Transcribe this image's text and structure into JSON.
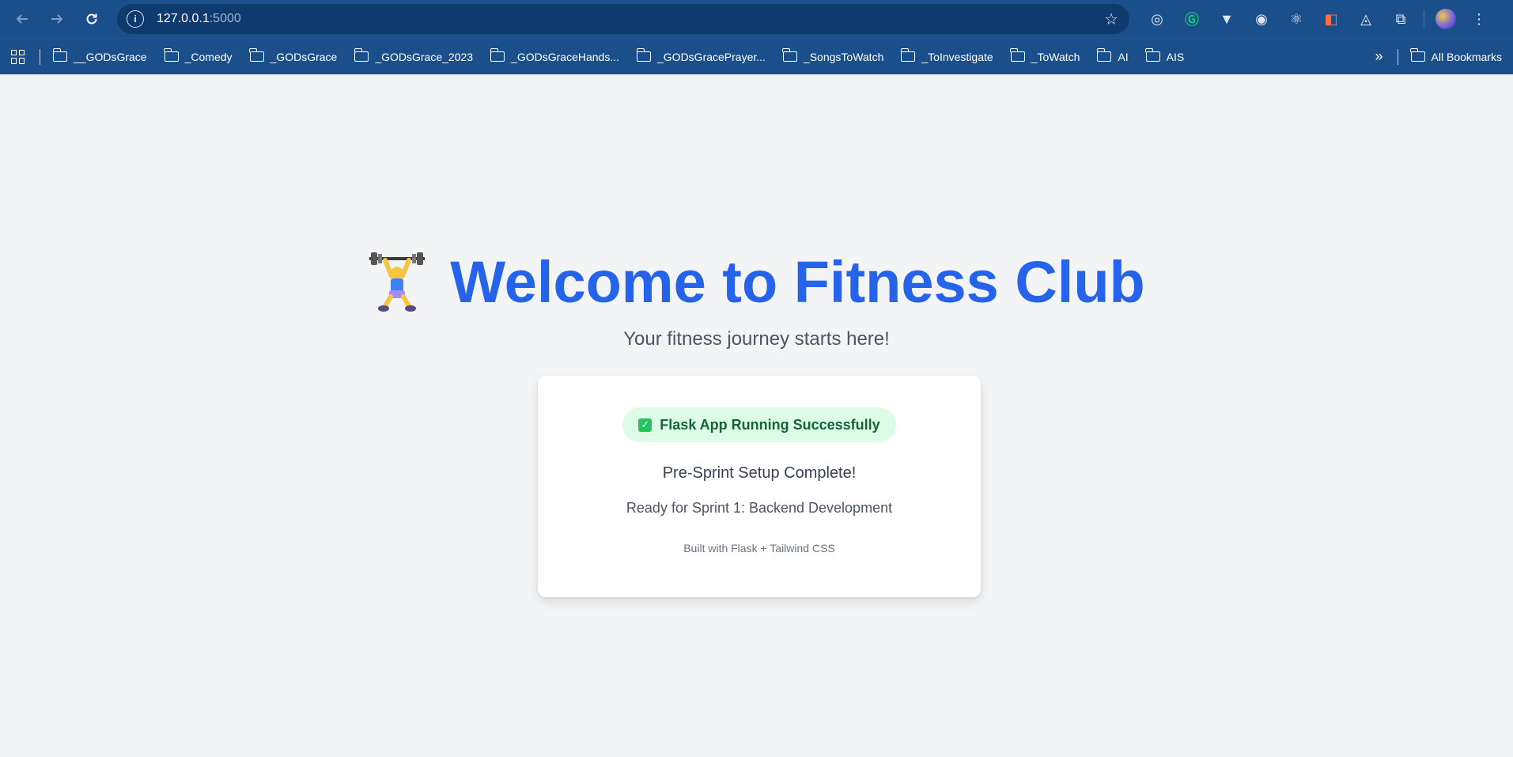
{
  "browser": {
    "url_host": "127.0.0.1",
    "url_port": ":5000",
    "icons": {
      "back": "arrow-left-icon",
      "forward": "arrow-right-icon",
      "reload": "reload-icon",
      "info": "info-icon",
      "bookmark_star": "star-icon"
    },
    "extensions": [
      "extension-1",
      "grammarly",
      "vue",
      "target",
      "react",
      "extension-orange",
      "extension-dark",
      "extensions-puzzle"
    ]
  },
  "bookmarks": {
    "items": [
      "__GODsGrace",
      "_Comedy",
      "_GODsGrace",
      "_GODsGrace_2023",
      "_GODsGraceHands...",
      "_GODsGracePrayer...",
      "_SongsToWatch",
      "_ToInvestigate",
      "_ToWatch",
      "AI",
      "AIS"
    ],
    "more": "»",
    "all_bookmarks": "All Bookmarks"
  },
  "hero": {
    "title": "Welcome to Fitness Club",
    "subtitle": "Your fitness journey starts here!",
    "icon": "weightlifter-icon"
  },
  "card": {
    "badge": "Flask App Running Successfully",
    "heading": "Pre-Sprint Setup Complete!",
    "status": "Ready for Sprint 1: Backend Development",
    "footer": "Built with Flask + Tailwind CSS"
  },
  "colors": {
    "chrome": "#1b4f8c",
    "title": "#2563eb",
    "badge_bg": "#dcfce7",
    "badge_text": "#166534",
    "page_bg": "#f3f4f6"
  }
}
